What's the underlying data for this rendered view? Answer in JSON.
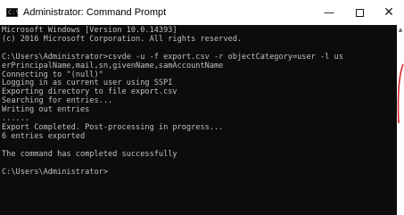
{
  "window": {
    "title": "Administrator: Command Prompt",
    "icon": "cmd-icon",
    "controls": {
      "minimize": "—",
      "maximize": "maximize-icon",
      "close": "✕"
    }
  },
  "console": {
    "lines": [
      "Microsoft Windows [Version 10.0.14393]",
      "(c) 2016 Microsoft Corporation. All rights reserved.",
      "",
      "C:\\Users\\Administrator>csvde -u -f export.csv -r objectCategory=user -l us",
      "erPrincipalName,mail,sn,givenName,samAccountName",
      "Connecting to \"(null)\"",
      "Logging in as current user using SSPI",
      "Exporting directory to file export.csv",
      "Searching for entries...",
      "Writing out entries",
      "......",
      "Export Completed. Post-processing in progress...",
      "6 entries exported",
      "",
      "The command has completed successfully",
      "",
      "C:\\Users\\Administrator>"
    ]
  },
  "colors": {
    "console_bg": "#0c0c0c",
    "console_text": "#c0c0c0",
    "titlebar_bg": "#ffffff",
    "annotation": "#d9262b"
  }
}
